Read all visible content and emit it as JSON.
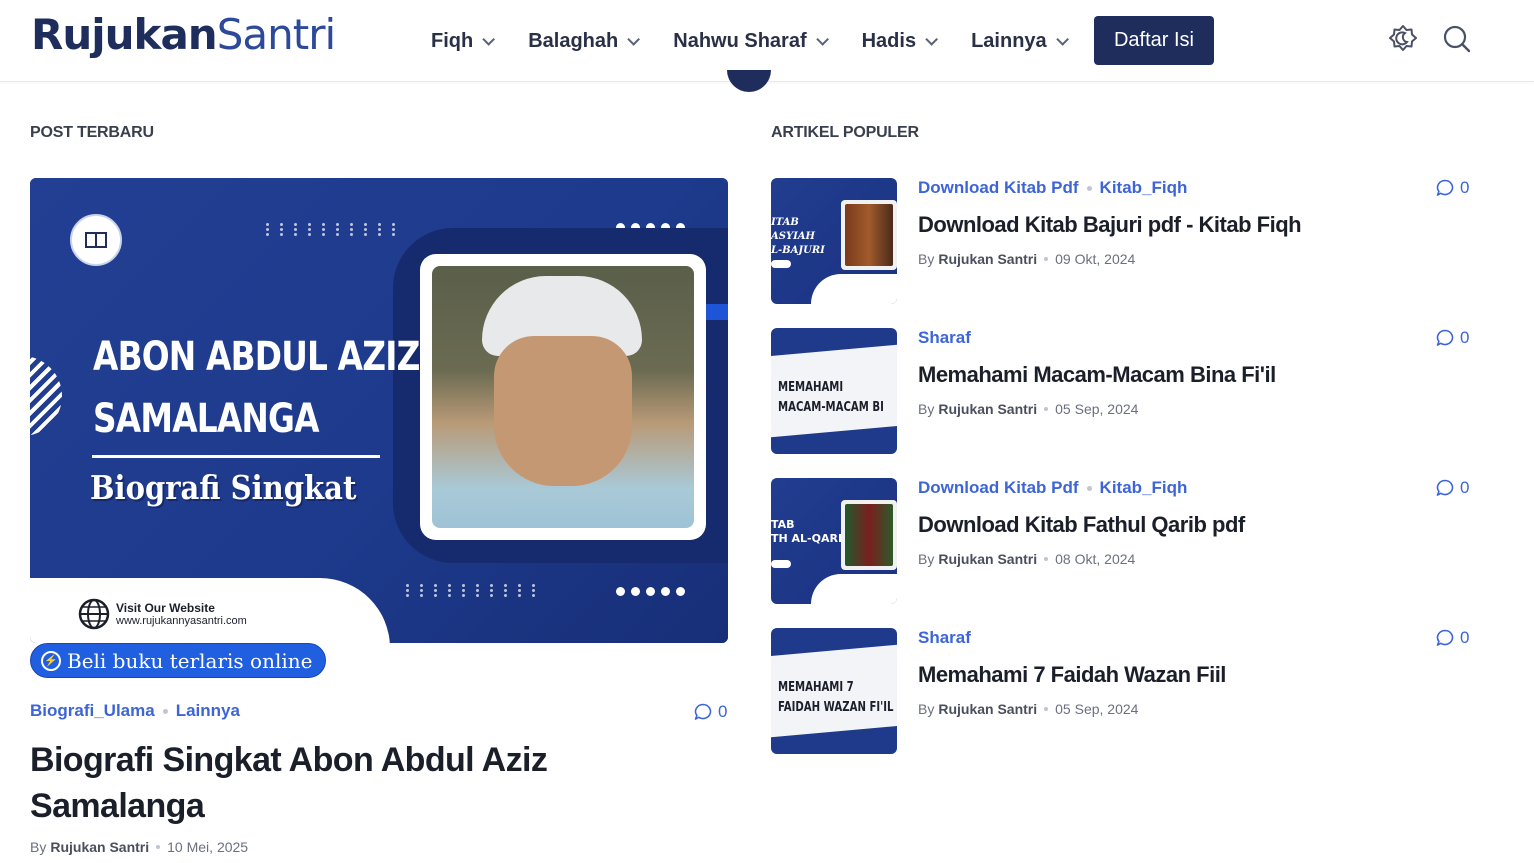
{
  "header": {
    "logo_part1": "Rujukan",
    "logo_part2": "Santri",
    "nav": [
      {
        "label": "Fiqh"
      },
      {
        "label": "Balaghah"
      },
      {
        "label": "Nahwu Sharaf"
      },
      {
        "label": "Hadis"
      },
      {
        "label": "Lainnya"
      }
    ],
    "cta_label": "Daftar Isi",
    "icons": [
      "theme-toggle-icon",
      "search-icon"
    ],
    "accent_color": "#1f2d5c"
  },
  "sections": {
    "latest_title": "POST TERBARU",
    "popular_title": "ARTIKEL POPULER"
  },
  "featured": {
    "image": {
      "headline_line1": "ABON ABDUL AZIZ",
      "headline_line2": "SAMALANGA",
      "subtitle": "Biografi Singkat",
      "visit_label": "Visit Our Website",
      "visit_url": "www.rujukannyasantri.com"
    },
    "promo_label": "Beli buku terlaris online",
    "categories": [
      "Biografi_Ulama",
      "Lainnya"
    ],
    "comments": "0",
    "title": "Biografi Singkat Abon Abdul Aziz Samalanga",
    "by": "By",
    "author": "Rujukan Santri",
    "date": "10 Mei, 2025"
  },
  "popular": [
    {
      "categories": [
        "Download Kitab Pdf",
        "Kitab_Fiqh"
      ],
      "title": "Download Kitab Bajuri pdf - Kitab Fiqh",
      "by": "By",
      "author": "Rujukan Santri",
      "date": "09 Okt, 2024",
      "comments": "0",
      "thumb_text": "ITAB\nASYIAH\nL-BAJURI"
    },
    {
      "categories": [
        "Sharaf"
      ],
      "title": "Memahami Macam-Macam Bina Fi'il",
      "by": "By",
      "author": "Rujukan Santri",
      "date": "05 Sep, 2024",
      "comments": "0",
      "thumb_text": "MEMAHAMI\nMACAM-MACAM BI"
    },
    {
      "categories": [
        "Download Kitab Pdf",
        "Kitab_Fiqh"
      ],
      "title": "Download Kitab Fathul Qarib pdf",
      "by": "By",
      "author": "Rujukan Santri",
      "date": "08 Okt, 2024",
      "comments": "0",
      "thumb_text": "TAB\nTH AL-QARIB"
    },
    {
      "categories": [
        "Sharaf"
      ],
      "title": "Memahami 7 Faidah Wazan Fiil",
      "by": "By",
      "author": "Rujukan Santri",
      "date": "05 Sep, 2024",
      "comments": "0",
      "thumb_text": "MEMAHAMI 7\nFAIDAH WAZAN FI'IL"
    }
  ]
}
